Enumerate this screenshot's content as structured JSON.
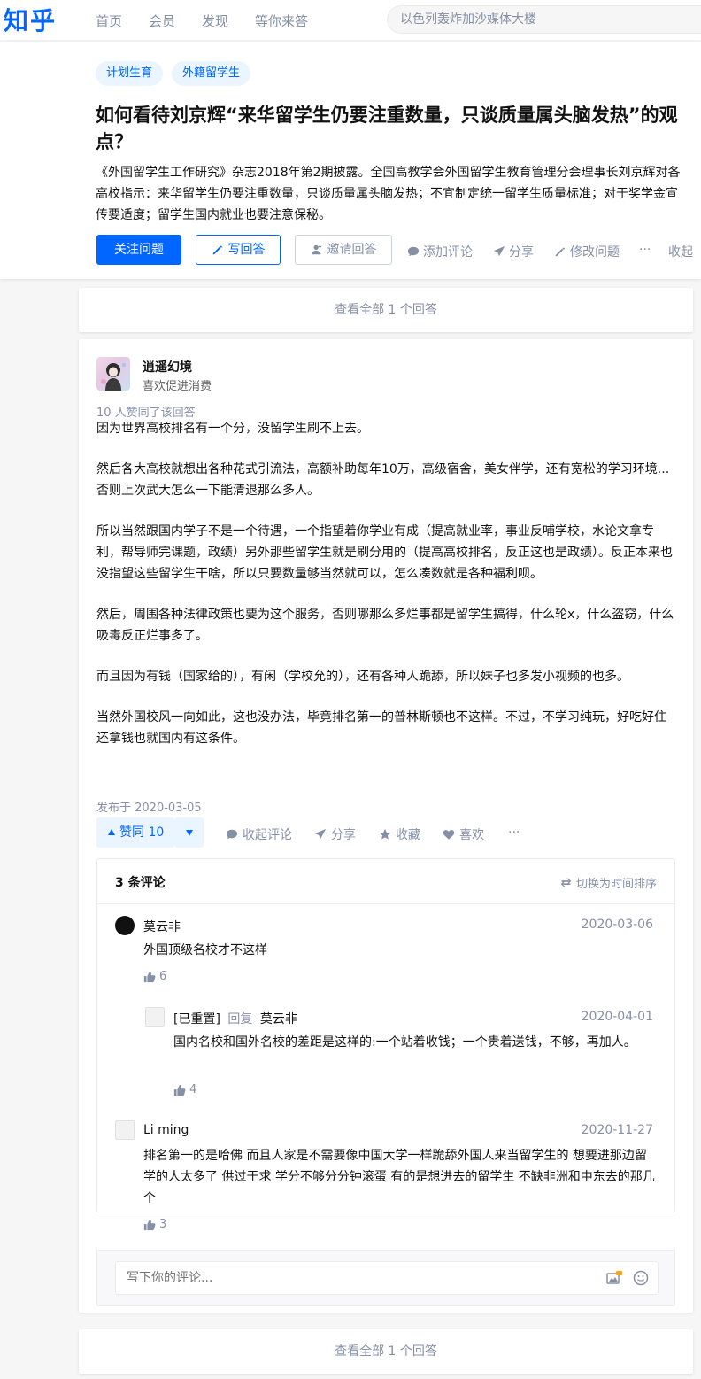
{
  "nav": {
    "logo": "知乎",
    "items": [
      "首页",
      "会员",
      "发现",
      "等你来答"
    ],
    "search_placeholder": "以色列轰炸加沙媒体大楼"
  },
  "question": {
    "tags": [
      "计划生育",
      "外籍留学生"
    ],
    "title": "如何看待刘京辉“来华留学生仍要注重数量，只谈质量属头脑发热”的观点？",
    "detail": "《外国留学生工作研究》杂志2018年第2期披露。全国高教学会外国留学生教育管理分会理事长刘京辉对各高校指示：来华留学生仍要注重数量，只谈质量属头脑发热；不宜制定统一留学生质量标准；对于奖学金宣传要适度；留学生国内就业也要注意保秘。",
    "follow_label": "关注问题",
    "write_label": "写回答",
    "invite_label": "邀请回答",
    "add_comment": "添加评论",
    "share": "分享",
    "edit": "修改问题",
    "more": "···",
    "collapse": "收起"
  },
  "view_all_top": "查看全部 1 个回答",
  "view_all_bottom": "查看全部 1 个回答",
  "answer": {
    "author": "逍遥幻境",
    "bio": "喜欢促进消费",
    "voters": "10 人赞同了该回答",
    "paragraphs": [
      "因为世界高校排名有一个分，没留学生刷不上去。",
      "然后各大高校就想出各种花式引流法，高额补助每年10万，高级宿舍，美女伴学，还有宽松的学习环境...否则上次武大怎么一下能清退那么多人。",
      "所以当然跟国内学子不是一个待遇，一个指望着你学业有成（提高就业率，事业反哺学校，水论文拿专利，帮导师完课题，政绩）另外那些留学生就是刷分用的（提高高校排名，反正这也是政绩）。反正本来也没指望这些留学生干啥，所以只要数量够当然就可以，怎么凑数就是各种福利呗。",
      "然后，周围各种法律政策也要为这个服务，否则哪那么多烂事都是留学生搞得，什么轮x，什么盗窃，什么吸毒反正烂事多了。",
      "而且因为有钱（国家给的），有闲（学校允的），还有各种人跪舔，所以妹子也多发小视频的也多。",
      "当然外国校风一向如此，这也没办法，毕竟排名第一的普林斯顿也不这样。不过，不学习纯玩，好吃好住还拿钱也就国内有这条件。"
    ],
    "published": "发布于 2020-03-05",
    "upvote_label": "赞同 10",
    "actions": {
      "collapse_comments": "收起评论",
      "share": "分享",
      "favorite": "收藏",
      "like": "喜欢",
      "more": "···"
    }
  },
  "comments": {
    "count_label": "3 条评论",
    "sort_label": "切换为时间排序",
    "input_placeholder": "写下你的评论...",
    "items": [
      {
        "name": "莫云非",
        "date": "2020-03-06",
        "text": "外国顶级名校才不这样",
        "likes": "6"
      },
      {
        "name": "[已重置]",
        "reply_label": "回复",
        "reply_to": "莫云非",
        "date": "2020-04-01",
        "text": "国内名校和国外名校的差距是这样的:一个站着收钱；一个贵着送钱，不够，再加人。",
        "likes": "4"
      },
      {
        "name": "Li ming",
        "date": "2020-11-27",
        "text": "排名第一的是哈佛 而且人家是不需要像中国大学一样跪舔外国人来当留学生的 想要进那边留学的人太多了 供过于求 学分不够分分钟滚蛋 有的是想进去的留学生 不缺非洲和中东去的那几个",
        "likes": "3"
      }
    ]
  },
  "colors": {
    "brand": "#0066ff",
    "muted": "#8590a6",
    "tag_bg": "#ebf5ff"
  }
}
